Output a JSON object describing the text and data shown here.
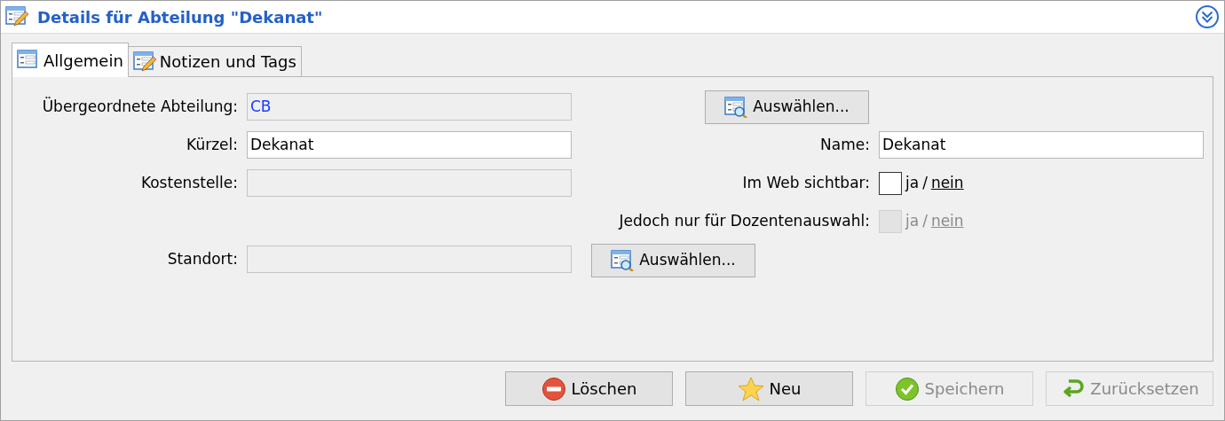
{
  "header": {
    "title": "Details für Abteilung \"Dekanat\""
  },
  "tabs": [
    {
      "label": "Allgemein",
      "selected": true,
      "kind": "form"
    },
    {
      "label": "Notizen und Tags",
      "selected": false,
      "kind": "notes"
    }
  ],
  "rows": [
    {
      "left": {
        "label": "Übergeordnete Abteilung:",
        "value": "CB",
        "disabled": true
      },
      "right": {
        "kind": "button",
        "label": "Auswählen..."
      }
    },
    {
      "left": {
        "label": "Kürzel:",
        "value": "Dekanat",
        "disabled": false
      },
      "right": {
        "kind": "text",
        "label": "Name:",
        "value": "Dekanat"
      }
    },
    {
      "left": {
        "label": "Kostenstelle:",
        "disabled": true
      },
      "right": {
        "kind": "toggle",
        "label": "Im Web sichtbar:",
        "checked": false,
        "disabled": false,
        "separator": "/",
        "options": [
          {
            "label": "ja",
            "selected": false
          },
          {
            "label": "nein",
            "selected": true
          }
        ]
      }
    },
    {
      "right": {
        "kind": "toggle",
        "label": "Jedoch nur für Dozentenauswahl:",
        "checked": false,
        "disabled": true,
        "separator": "/",
        "options": [
          {
            "label": "ja",
            "selected": false
          },
          {
            "label": "nein",
            "selected": true
          }
        ]
      }
    },
    {
      "left": {
        "label": "Standort:",
        "disabled": true
      },
      "right": {
        "kind": "inline_button",
        "label": "Auswählen..."
      }
    }
  ],
  "buttons": [
    {
      "label": "Löschen",
      "kind": "delete",
      "disabled": false
    },
    {
      "label": "Neu",
      "kind": "new",
      "disabled": false
    },
    {
      "label": "Speichern",
      "kind": "save",
      "disabled": true
    },
    {
      "label": "Zurücksetzen",
      "kind": "reset",
      "disabled": true
    }
  ]
}
